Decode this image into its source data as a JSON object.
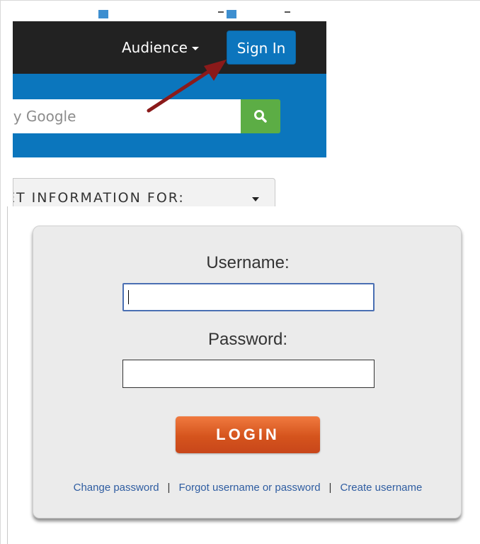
{
  "navbar": {
    "audience_label": "Audience",
    "signin_label": "Sign In"
  },
  "search": {
    "placeholder_visible": "by Google",
    "icon": "search-icon"
  },
  "info_dropdown": {
    "label_visible": "ET INFORMATION FOR:"
  },
  "login": {
    "username_label": "Username:",
    "password_label": "Password:",
    "username_value": "",
    "password_value": "",
    "button_label": "LOGIN",
    "links": {
      "change_password": "Change password",
      "forgot": "Forgot username or password",
      "create": "Create username",
      "separator": "|"
    }
  },
  "colors": {
    "navbar": "#222222",
    "brand_blue": "#0b76bd",
    "search_green": "#5cad45",
    "login_orange": "#d5541d",
    "arrow_red": "#8b1a1a",
    "link_blue": "#2f5da1"
  }
}
